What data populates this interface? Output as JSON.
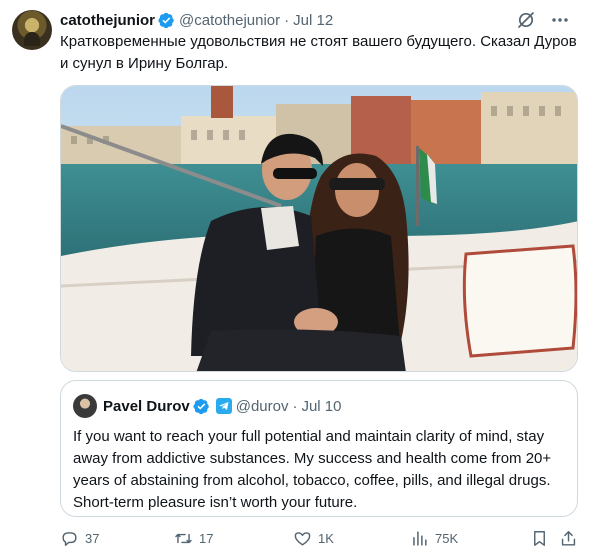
{
  "author": {
    "name": "catothejunior",
    "handle": "@catothejunior",
    "separator": "·",
    "date": "Jul 12"
  },
  "tweet_text": "Кратковременные удовольствия не стоят вашего будущего. Сказал Дуров и сунул в Ирину Болгар.",
  "quoted": {
    "name": "Pavel Durov",
    "handle": "@durov",
    "separator": "·",
    "date": "Jul 10",
    "text": "If you want to reach your full potential and maintain clarity of mind, stay away from addictive substances. My success and health come from 20+ years of abstaining from alcohol, tobacco, coffee, pills, and illegal drugs. Short-term pleasure isn’t worth your future."
  },
  "actions": {
    "replies": "37",
    "reposts": "17",
    "likes": "1K",
    "views": "75K"
  },
  "icons": {
    "header": [
      "verified-badge-icon",
      "grok-icon",
      "more-icon"
    ],
    "quoted_header": [
      "verified-badge-icon",
      "telegram-icon"
    ],
    "actions": [
      "reply-icon",
      "repost-icon",
      "like-icon",
      "views-icon",
      "bookmark-icon",
      "share-icon"
    ]
  },
  "colors": {
    "verified_blue": "#1d9bf0",
    "text_primary": "#0f1419",
    "text_secondary": "#536471",
    "border": "#cfd9de"
  }
}
